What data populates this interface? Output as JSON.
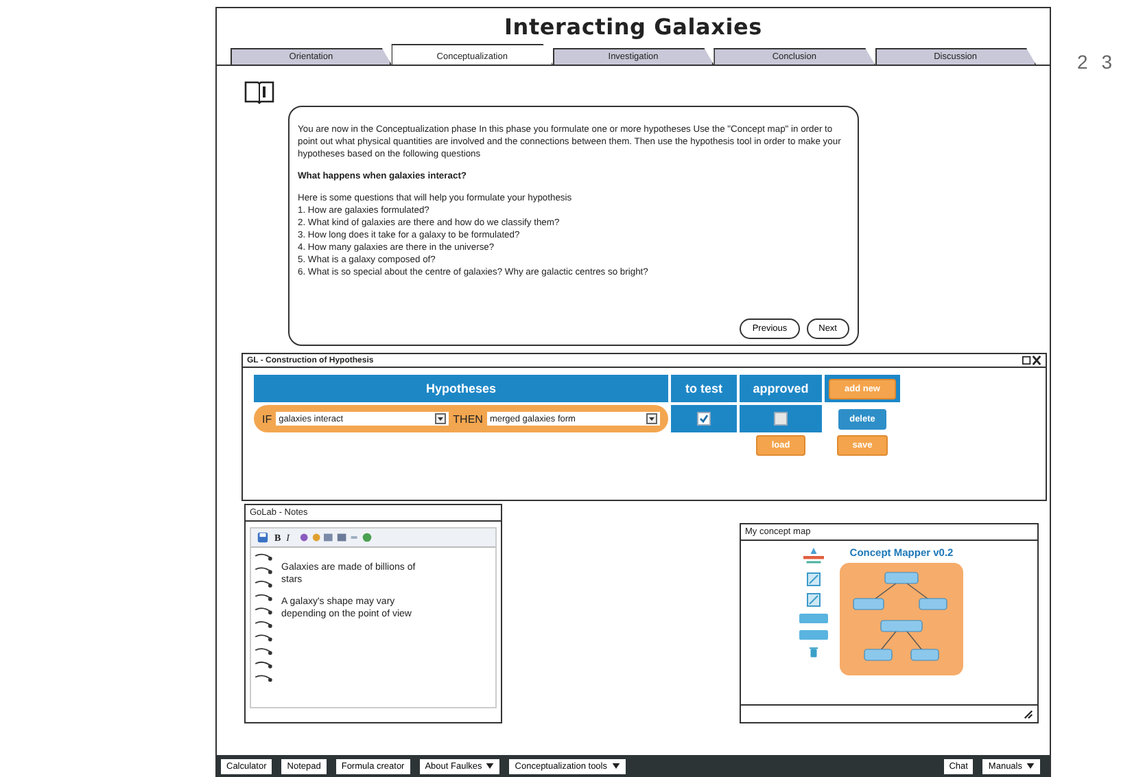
{
  "window": {
    "title": "Interacting Galaxies"
  },
  "tabs": [
    {
      "label": "Orientation",
      "selected": false
    },
    {
      "label": "Conceptualization",
      "selected": true
    },
    {
      "label": "Investigation",
      "selected": false
    },
    {
      "label": "Conclusion",
      "selected": false
    },
    {
      "label": "Discussion",
      "selected": false
    }
  ],
  "page_numbers": [
    "2",
    "3"
  ],
  "intro": {
    "paragraph": "You are now in the Conceptualization phase In this phase you formulate one or more hypotheses Use the \"Concept map\" in order to point out what physical quantities are involved and the connections between them. Then use the hypothesis tool in order to make your hypotheses based on the following questions",
    "question": "What happens when galaxies interact?",
    "lead": "Here is some questions that will help you formulate your hypothesis",
    "questions": [
      "1. How are galaxies formulated?",
      "2. What kind of galaxies are there and how do we classify them?",
      "3. How long does it take for a galaxy to be formulated?",
      "4. How many galaxies are there in the universe?",
      "5. What is a galaxy composed of?",
      "6. What is so special about the centre of galaxies? Why are galactic centres so bright?"
    ],
    "buttons": [
      "Previous",
      "Next"
    ]
  },
  "hypothesis_panel": {
    "title": "GL - Construction of Hypothesis",
    "columns": [
      "Hypotheses",
      "to test",
      "approved"
    ],
    "add_button": "add new",
    "rows": [
      {
        "if_label": "IF",
        "condition": "galaxies interact",
        "then_label": "THEN",
        "result": "merged galaxies form",
        "to_test": true,
        "approved": false,
        "delete_button": "delete"
      }
    ],
    "buttons": [
      "load",
      "save"
    ]
  },
  "notes": {
    "title": "GoLab - Notes",
    "toolbar": [
      "B",
      "I"
    ],
    "lines": [
      "Galaxies are made of billions of stars",
      "A galaxy's shape may vary depending on the point of view"
    ]
  },
  "concept_map": {
    "title": "My concept map",
    "app_title": "Concept Mapper v0.2"
  },
  "taskbar_left": [
    {
      "label": "Calculator",
      "dropdown": false
    },
    {
      "label": "Notepad",
      "dropdown": false
    },
    {
      "label": "Formula creator",
      "dropdown": false
    },
    {
      "label": "About Faulkes",
      "dropdown": true
    },
    {
      "label": "Conceptualization tools",
      "dropdown": true
    }
  ],
  "taskbar_right": [
    {
      "label": "Chat",
      "dropdown": false
    },
    {
      "label": "Manuals",
      "dropdown": true
    }
  ]
}
